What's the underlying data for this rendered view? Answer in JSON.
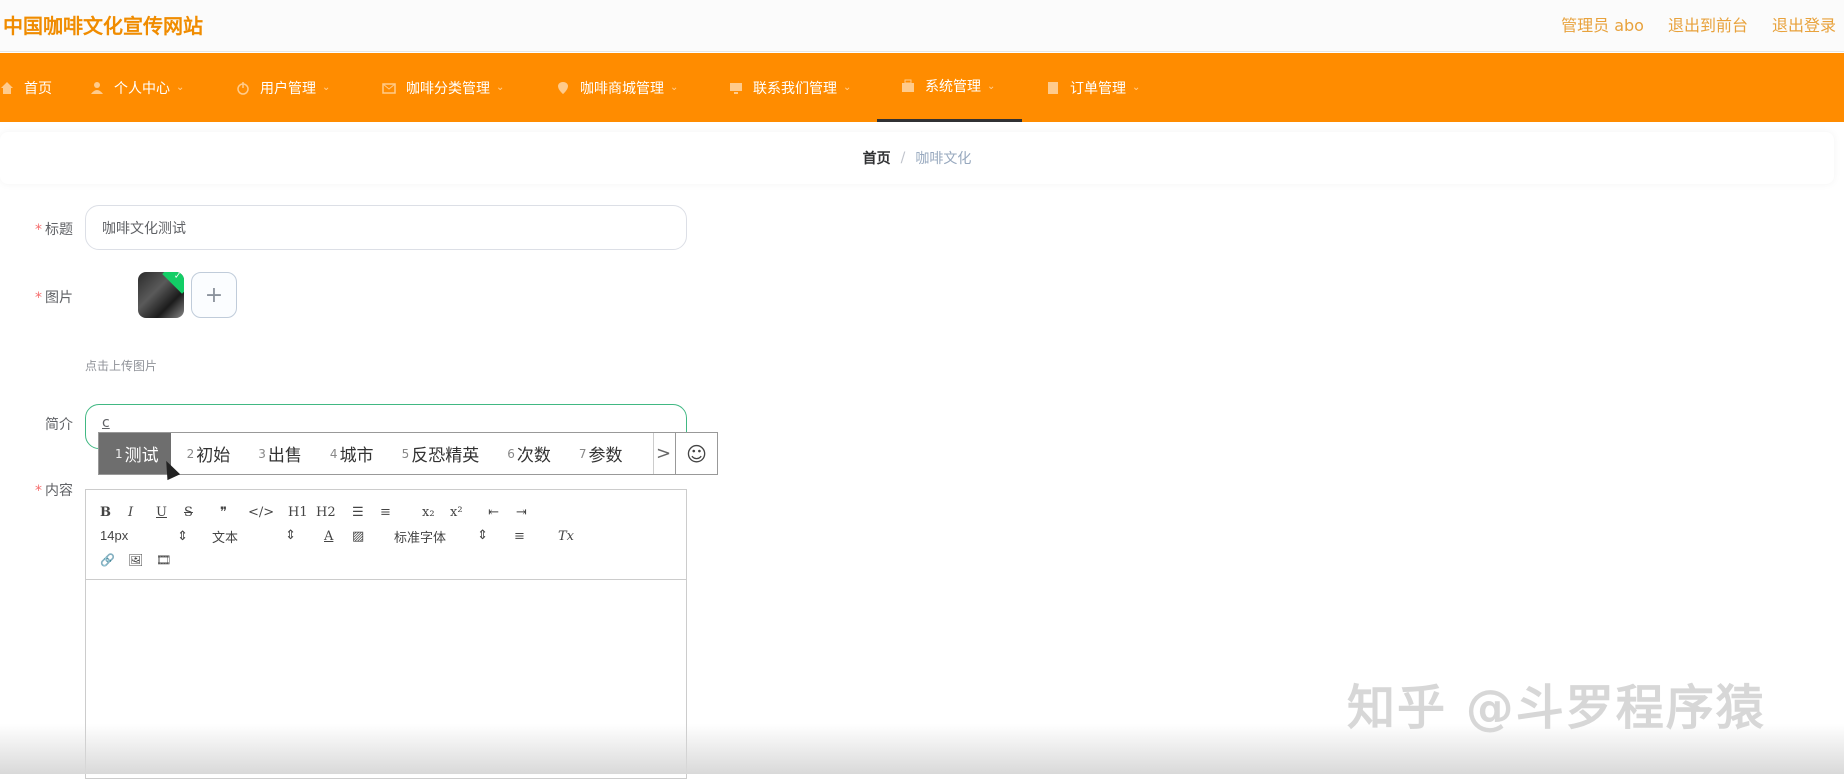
{
  "header": {
    "site_title": "中国咖啡文化宣传网站",
    "links": [
      "管理员 abo",
      "退出到前台",
      "退出登录"
    ]
  },
  "nav": {
    "items": [
      {
        "label": "首页",
        "icon": "home-icon"
      },
      {
        "label": "个人中心",
        "icon": "user-icon"
      },
      {
        "label": "用户管理",
        "icon": "power-icon"
      },
      {
        "label": "咖啡分类管理",
        "icon": "mail-icon"
      },
      {
        "label": "咖啡商城管理",
        "icon": "location-icon"
      },
      {
        "label": "联系我们管理",
        "icon": "monitor-icon"
      },
      {
        "label": "系统管理",
        "icon": "briefcase-icon",
        "active": true
      },
      {
        "label": "订单管理",
        "icon": "document-icon"
      }
    ]
  },
  "breadcrumb": {
    "home": "首页",
    "separator": "/",
    "current": "咖啡文化"
  },
  "form": {
    "title_label": "标题",
    "title_value": "咖啡文化测试",
    "image_label": "图片",
    "upload_hint": "点击上传图片",
    "intro_label": "简介",
    "intro_value": "c",
    "content_label": "内容",
    "required_mark": "*"
  },
  "ime": {
    "candidates": [
      {
        "n": "1",
        "text": "测试"
      },
      {
        "n": "2",
        "text": "初始"
      },
      {
        "n": "3",
        "text": "出售"
      },
      {
        "n": "4",
        "text": "城市"
      },
      {
        "n": "5",
        "text": "反恐精英"
      },
      {
        "n": "6",
        "text": "次数"
      },
      {
        "n": "7",
        "text": "参数"
      }
    ],
    "next_arrow": ">",
    "emoji": "☺"
  },
  "editor": {
    "row1": [
      "B",
      "I",
      "U",
      "S",
      "❞",
      "</>",
      "H1",
      "H2",
      "☰",
      "≡",
      "x₂",
      "x²",
      "⇤",
      "⇥"
    ],
    "font_size": "14px",
    "text_style": "文本",
    "font_family": "标准字体",
    "row2_icons": [
      "A",
      "▨",
      "≡",
      "Tx"
    ],
    "row3": [
      "🔗",
      "🖼",
      "🎞"
    ]
  },
  "watermark": "知乎 @斗罗程序猿",
  "colors": {
    "accent": "#ff8c00",
    "title": "#f08c00",
    "success": "#13ce66"
  }
}
